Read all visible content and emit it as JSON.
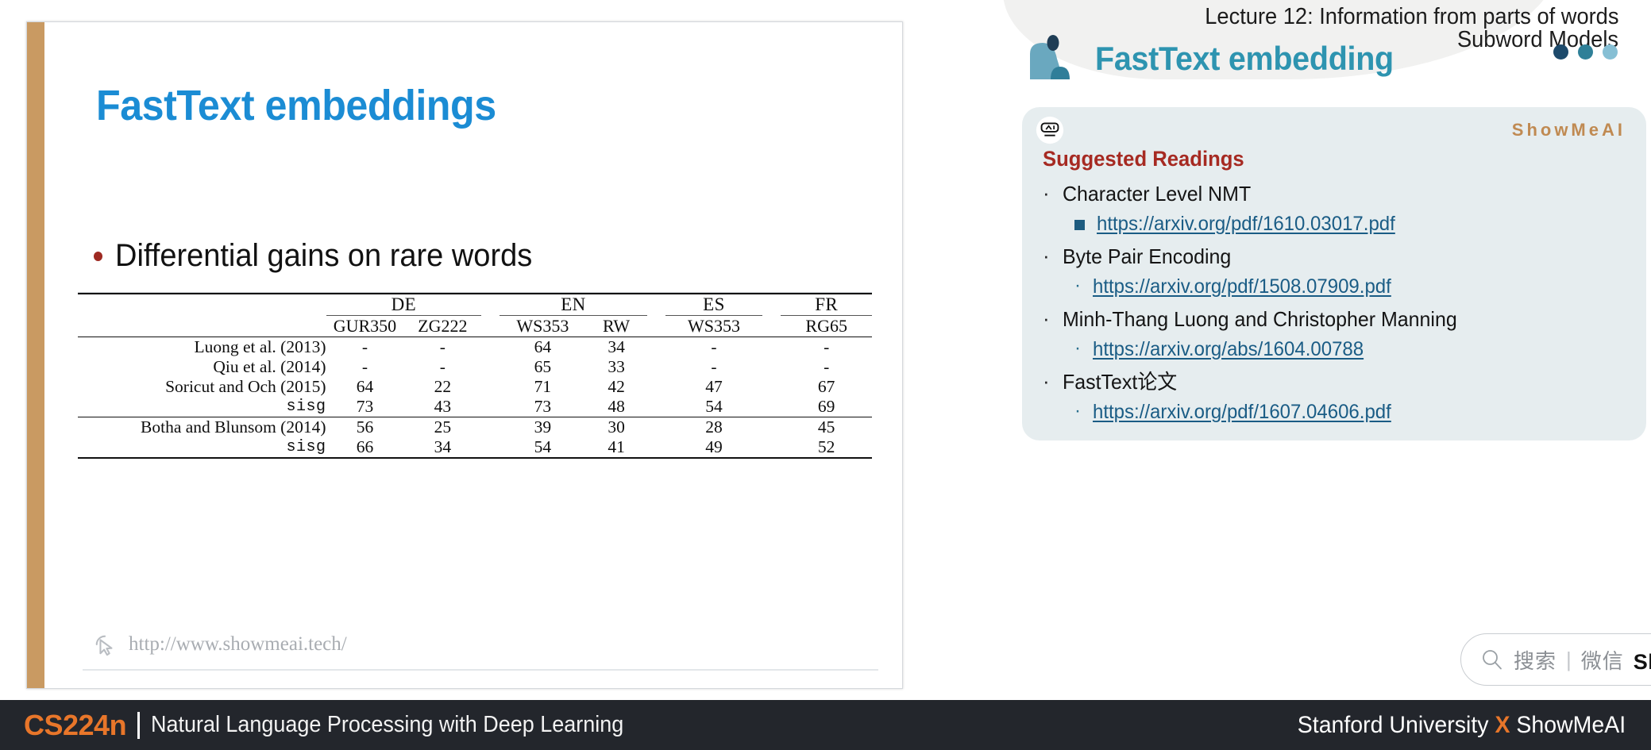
{
  "header": {
    "lecture_line1": "Lecture 12: Information from parts of words",
    "lecture_line2": "Subword Models",
    "panel_title": "FastText embedding",
    "dot_colors": [
      "#1d4a6b",
      "#2f8098",
      "#86bfd4"
    ]
  },
  "slide": {
    "title": "FastText embeddings",
    "bullet": "Differential gains on rare words",
    "watermark_url": "http://www.showmeai.tech/",
    "accent_color": "#c99a62",
    "title_color": "#1b8cd4"
  },
  "table": {
    "group_headers": [
      "",
      "DE",
      "EN",
      "ES",
      "FR"
    ],
    "sub_headers": [
      "",
      "GUR350",
      "ZG222",
      "WS353",
      "RW",
      "WS353",
      "RG65"
    ],
    "rows_group1": [
      {
        "name": "Luong et al. (2013)",
        "mono": false,
        "values": [
          "-",
          "-",
          "64",
          "34",
          "-",
          "-"
        ]
      },
      {
        "name": "Qiu et al. (2014)",
        "mono": false,
        "values": [
          "-",
          "-",
          "65",
          "33",
          "-",
          "-"
        ]
      },
      {
        "name": "Soricut and Och (2015)",
        "mono": false,
        "values": [
          "64",
          "22",
          "71",
          "42",
          "47",
          "67"
        ]
      },
      {
        "name": "sisg",
        "mono": true,
        "values": [
          "73",
          "43",
          "73",
          "48",
          "54",
          "69"
        ]
      }
    ],
    "rows_group2": [
      {
        "name": "Botha and Blunsom (2014)",
        "mono": false,
        "values": [
          "56",
          "25",
          "39",
          "30",
          "28",
          "45"
        ]
      },
      {
        "name": "sisg",
        "mono": true,
        "values": [
          "66",
          "34",
          "54",
          "41",
          "49",
          "52"
        ]
      }
    ]
  },
  "card": {
    "brand": "ShowMeAI",
    "heading": "Suggested Readings",
    "heading_color": "#a62a22",
    "items": [
      {
        "label": "Character Level NMT",
        "link": "https://arxiv.org/pdf/1610.03017.pdf",
        "marker": "square"
      },
      {
        "label": "Byte Pair Encoding",
        "link": "https://arxiv.org/pdf/1508.07909.pdf",
        "marker": "dot"
      },
      {
        "label": "Minh-Thang Luong and Christopher Manning",
        "link": "https://arxiv.org/abs/1604.00788",
        "marker": "dot"
      },
      {
        "label": "FastText论文",
        "link": "https://arxiv.org/pdf/1607.04606.pdf",
        "marker": "dot"
      }
    ]
  },
  "search": {
    "placeholder_cn": "搜索",
    "separator": "|",
    "channel_cn": "微信",
    "brand": "ShowMeAI研究中心"
  },
  "footer": {
    "course_code": "CS224n",
    "course_name": "Natural Language Processing with Deep Learning",
    "right_prefix": "Stanford University ",
    "right_x": "X",
    "right_suffix": " ShowMeAI",
    "accent_color": "#e8762a"
  }
}
